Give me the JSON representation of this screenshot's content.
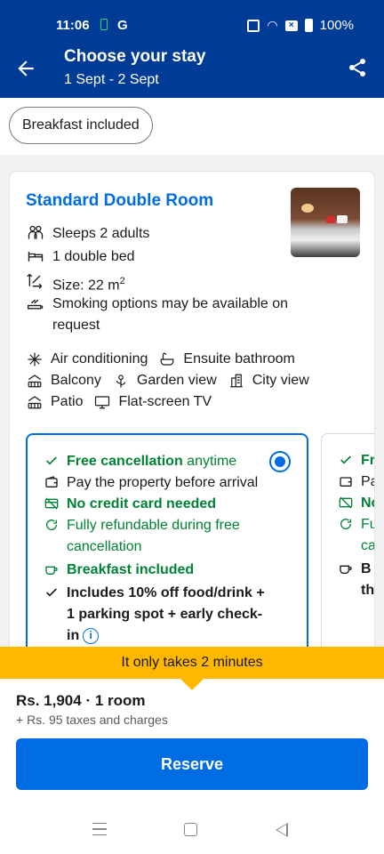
{
  "status_bar": {
    "time": "11:06",
    "carrier_icon": "G",
    "battery_text": "100%"
  },
  "header": {
    "title": "Choose your stay",
    "dates": "1 Sept - 2 Sept"
  },
  "filters": {
    "chip": "Breakfast included"
  },
  "room": {
    "name": "Standard Double Room",
    "features": [
      {
        "icon": "people-icon",
        "text": "Sleeps 2 adults"
      },
      {
        "icon": "bed-icon",
        "text": "1 double bed"
      },
      {
        "icon": "size-icon",
        "text": "Size: 22 m",
        "sup": "2"
      },
      {
        "icon": "smoking-icon",
        "text": "Smoking options may be available on request"
      }
    ],
    "amenities": [
      "Air conditioning",
      "Ensuite bathroom",
      "Balcony",
      "Garden view",
      "City view",
      "Patio",
      "Flat-screen TV"
    ]
  },
  "offer": {
    "free_cancel_bold": "Free cancellation",
    "free_cancel_rest": " anytime",
    "pay_property": "Pay the property before arrival",
    "no_card": "No credit card needed",
    "refundable": "Fully refundable during free cancellation",
    "breakfast": "Breakfast included",
    "includes": "Includes 10% off food/drink + 1 parking spot + early check-in",
    "info_glyph": "i"
  },
  "offer2": {
    "l1": "Fr",
    "l2": "Pa",
    "l3": "No",
    "l4a": "Fu",
    "l4b": "ca",
    "l5a": "B",
    "l5b": "th"
  },
  "banner": {
    "text": "It only takes 2 minutes"
  },
  "booking": {
    "price": "Rs. 1,904 · 1 room",
    "taxes": "+ Rs. 95 taxes and charges",
    "reserve": "Reserve"
  },
  "colors": {
    "brand": "#003b95",
    "accent": "#006ce4",
    "green": "#008234",
    "banner": "#ffb700"
  }
}
